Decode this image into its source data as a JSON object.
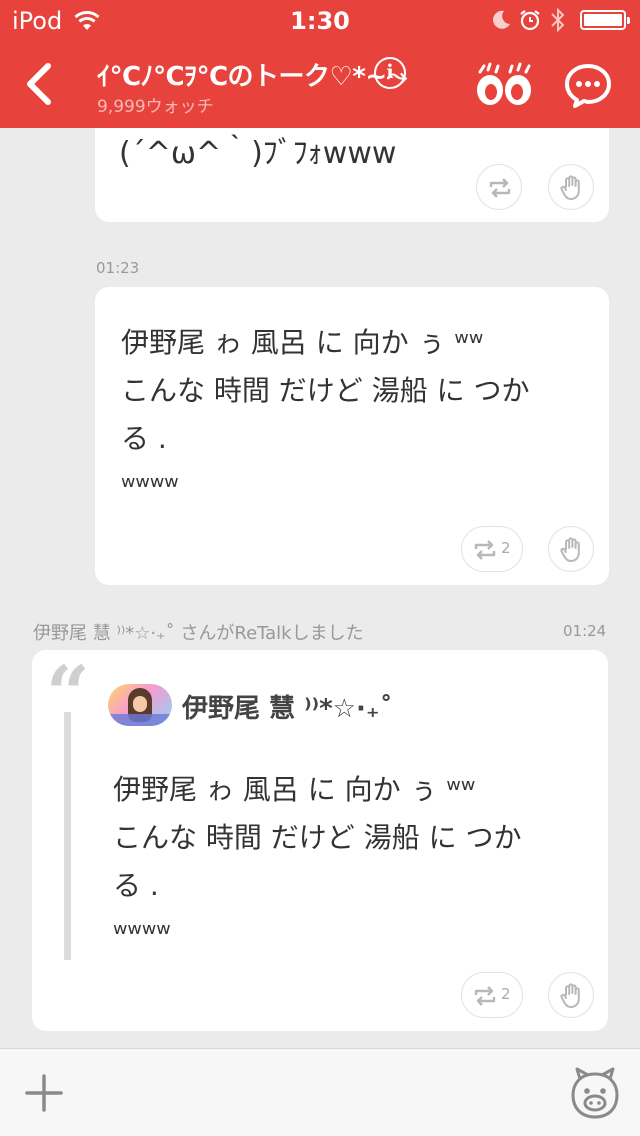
{
  "status_bar": {
    "carrier": "iPod",
    "time": "1:30"
  },
  "header": {
    "title": "ｲ℃ﾉ℃ｦ℃のトーク♡*~⤳",
    "watch_count": "9,999ウォッチ",
    "back_icon": "chevron-left-icon",
    "info_icon": "info-icon",
    "watch_icon": "eyes-icon",
    "chat_icon": "chat-bubble-icon"
  },
  "feed": {
    "partial_message": "(´^ω^｀)ﾌﾞﾌｫwww",
    "timestamp_1": "01:23",
    "message_2": "伊野尾 ゎ 風呂 に 向か ぅ ʷʷ\nこんな 時間 だけど 湯船 に つか\nる .\nʷʷʷʷ",
    "message_2_retalk_count": "2",
    "retalk_notice": "伊野尾 慧 ⁾⁾*☆·₊˚ さんがReTalkしました",
    "timestamp_2": "01:24",
    "quoted_user": "伊野尾 慧 ⁾⁾*☆·₊˚",
    "quoted_message": "伊野尾 ゎ 風呂 に 向か ぅ ʷʷ\nこんな 時間 だけど 湯船 に つか\nる .\nʷʷʷʷ",
    "quoted_retalk_count": "2"
  },
  "bottom_bar": {
    "add_icon": "plus-icon",
    "mascot_icon": "mascot-icon"
  },
  "colors": {
    "accent": "#e8423c",
    "background": "#ebebeb",
    "card": "#ffffff"
  }
}
